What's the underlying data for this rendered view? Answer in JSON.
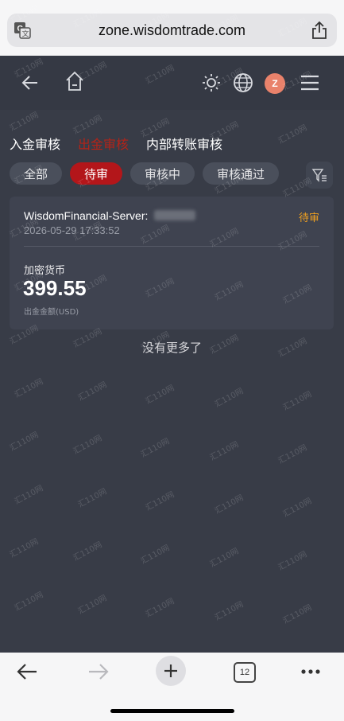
{
  "browser": {
    "url": "zone.wisdomtrade.com",
    "translate_icon": "translate-icon",
    "share_icon": "share-icon"
  },
  "header": {
    "icons": [
      "back-arrow-icon",
      "home-icon",
      "sun-icon",
      "globe-icon",
      "avatar",
      "menu-icon"
    ],
    "avatar_letter": "Z",
    "avatar_color": "#e9826b"
  },
  "review_tabs": [
    {
      "label": "入金审核",
      "active": false
    },
    {
      "label": "出金审核",
      "active": true
    },
    {
      "label": "内部转账审核",
      "active": false
    }
  ],
  "filter_chips": [
    {
      "label": "全部",
      "active": false
    },
    {
      "label": "待审",
      "active": true
    },
    {
      "label": "审核中",
      "active": false
    },
    {
      "label": "审核通过",
      "active": false
    }
  ],
  "filter_icon": "filter-icon",
  "record": {
    "server": "WisdomFinancial-Server:",
    "status": "待审",
    "status_color": "#f0a020",
    "timestamp": "2026-05-29 17:33:52",
    "method": "加密货币",
    "amount": "399.55",
    "amount_label": "出金金额(USD)"
  },
  "footer_text": "没有更多了",
  "watermark": "汇110网",
  "bottom_bar": {
    "tab_count": "12",
    "icons": [
      "back-icon",
      "forward-icon",
      "new-tab-icon",
      "tabs-icon",
      "more-icon"
    ]
  },
  "colors": {
    "accent": "#b3161a",
    "background": "#383c47",
    "card": "#3f4350"
  }
}
